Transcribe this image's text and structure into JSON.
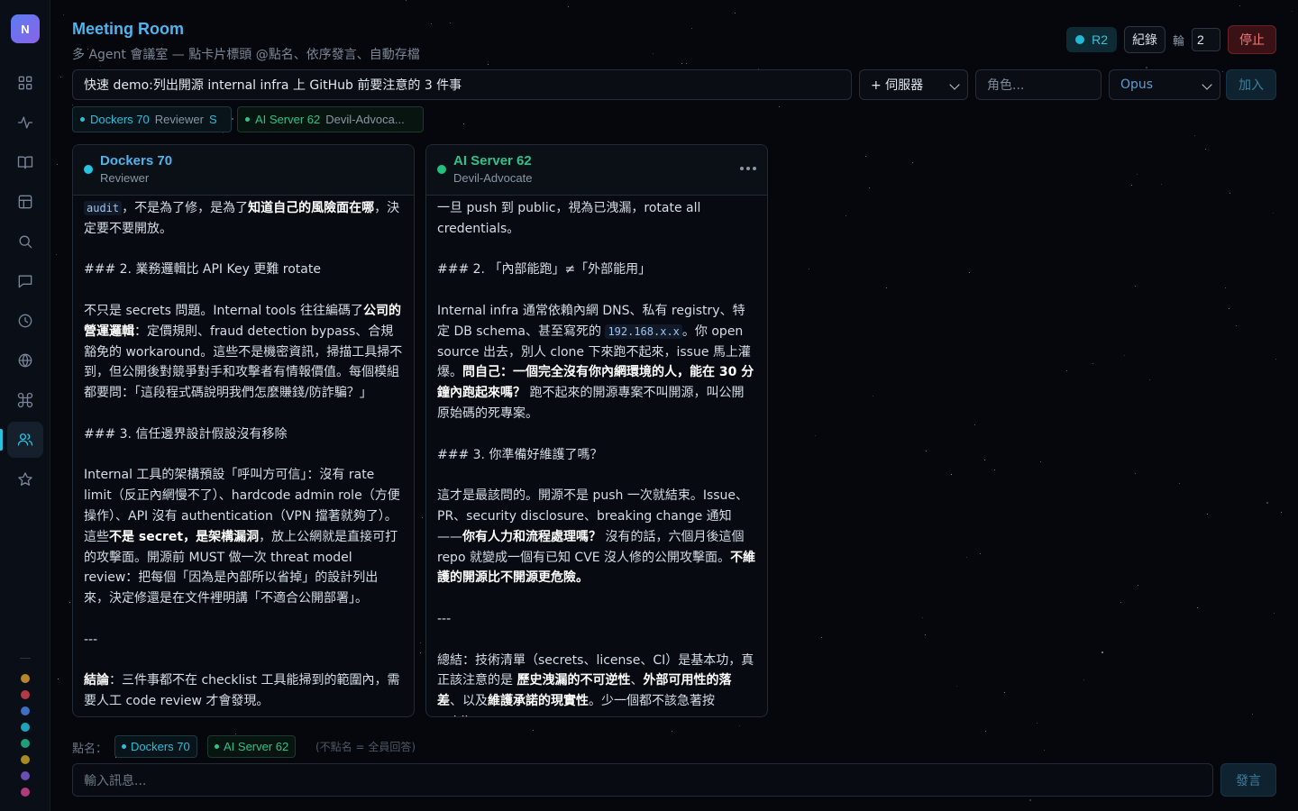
{
  "app": {
    "logo_letter": "N",
    "title": "Meeting Room",
    "subtitle": "多 Agent 會議室 — 點卡片標頭 @點名、依序發言、自動存檔"
  },
  "sidebar": {
    "items": [
      {
        "name": "dashboard",
        "icon": "grid-icon"
      },
      {
        "name": "activity",
        "icon": "activity-icon"
      },
      {
        "name": "docs",
        "icon": "book-icon"
      },
      {
        "name": "layout",
        "icon": "layout-icon"
      },
      {
        "name": "search",
        "icon": "search-icon"
      },
      {
        "name": "chat",
        "icon": "message-icon"
      },
      {
        "name": "history",
        "icon": "clock-icon"
      },
      {
        "name": "network",
        "icon": "globe-icon"
      },
      {
        "name": "commands",
        "icon": "command-icon"
      },
      {
        "name": "meeting",
        "icon": "users-icon",
        "active": true
      },
      {
        "name": "favorites",
        "icon": "star-icon"
      }
    ],
    "status_dots": [
      "#b8862a",
      "#b33a45",
      "#3f6fbf",
      "#1fa3bd",
      "#1f9e7a",
      "#a88a1f",
      "#6a4fb3",
      "#b33a7a"
    ]
  },
  "header": {
    "round_badge": "R2",
    "record_button": "紀錄",
    "round_label": "輪",
    "round_value": "2",
    "stop_button": "停止"
  },
  "controls": {
    "topic_value": "快速 demo:列出開源 internal infra 上 GitHub 前要注意的 3 件事",
    "server_select": "+ 伺服器",
    "role_placeholder": "角色...",
    "model_select": "Opus",
    "join_button": "加入"
  },
  "participants": [
    {
      "name": "Dockers 70",
      "role": "Reviewer",
      "extra": "S",
      "color": "#2bbfdc"
    },
    {
      "name": "AI Server 62",
      "role": "Devil-Advoca...",
      "extra": "",
      "color": "#2ec28a"
    }
  ],
  "cards": [
    {
      "name": "Dockers 70",
      "role": "Reviewer",
      "name_color": "#4fb4ec",
      "status_color": "#27c3e0",
      "paragraphs": [
        [
          {
            "c": "audit"
          },
          {
            "t": "，不是為了修，是為了"
          },
          {
            "b": "知道自己的風險面在哪"
          },
          {
            "t": "，決定要不要開放。"
          }
        ],
        [
          {
            "t": "### 2. 業務邏輯比 API Key 更難 rotate"
          }
        ],
        [
          {
            "t": "不只是 secrets 問題。Internal tools 往往編碼了"
          },
          {
            "b": "公司的營運邏輯"
          },
          {
            "t": "：定價規則、fraud detection bypass、合規豁免的 workaround。這些不是機密資訊，掃描工具掃不到，但公開後對競爭對手和攻擊者有情報價值。每個模組都要問：「這段程式碼說明我們怎麼賺錢/防詐騙？」"
          }
        ],
        [
          {
            "t": "### 3. 信任邊界設計假設沒有移除"
          }
        ],
        [
          {
            "t": "Internal 工具的架構預設「呼叫方可信」：沒有 rate limit（反正內網慢不了）、hardcode admin role（方便操作）、API 沒有 authentication（VPN 擋著就夠了）。這些"
          },
          {
            "b": "不是 secret，是架構漏洞"
          },
          {
            "t": "，放上公網就是直接可打的攻擊面。開源前 MUST 做一次 threat model review：把每個「因為是內部所以省掉」的設計列出來，決定修還是在文件裡明講「不適合公開部署」。"
          }
        ],
        [
          {
            "t": "---"
          }
        ],
        [
          {
            "b": "結論"
          },
          {
            "t": "：三件事都不在 checklist 工具能掃到的範圍內，需要人工 code review 才會發現。"
          }
        ]
      ]
    },
    {
      "name": "AI Server 62",
      "role": "Devil-Advocate",
      "name_color": "#2ec28a",
      "status_color": "#22c07a",
      "paragraphs": [
        [
          {
            "t": "一旦 push 到 public，視為已洩漏，rotate all credentials。"
          }
        ],
        [
          {
            "t": "### 2. 「內部能跑」≠「外部能用」"
          }
        ],
        [
          {
            "t": "Internal infra 通常依賴內網 DNS、私有 registry、特定 DB schema、甚至寫死的 "
          },
          {
            "c": "192.168.x.x"
          },
          {
            "t": "。你 open source 出去，別人 clone 下來跑不起來，issue 馬上灌爆。"
          },
          {
            "b": "問自己：一個完全沒有你內網環境的人，能在 30 分鐘內跑起來嗎？"
          },
          {
            "t": " 跑不起來的開源專案不叫開源，叫公開原始碼的死專案。"
          }
        ],
        [
          {
            "t": "### 3. 你準備好維護了嗎？"
          }
        ],
        [
          {
            "t": "這才是最該問的。開源不是 push 一次就結束。Issue、PR、security disclosure、breaking change 通知——"
          },
          {
            "b": "你有人力和流程處理嗎？"
          },
          {
            "t": " 沒有的話，六個月後這個 repo 就變成一個有已知 CVE 沒人修的公開攻擊面。"
          },
          {
            "b": "不維護的開源比不開源更危險。"
          }
        ],
        [
          {
            "t": "---"
          }
        ],
        [
          {
            "t": "總結：技術清單（secrets、license、CI）是基本功，真正該注意的是 "
          },
          {
            "b": "歷史洩漏的不可逆性"
          },
          {
            "t": "、"
          },
          {
            "b": "外部可用性的落差"
          },
          {
            "t": "、以及"
          },
          {
            "b": "維護承諾的現實性"
          },
          {
            "t": "。少一個都不該急著按 public。"
          }
        ]
      ]
    }
  ],
  "footer": {
    "mention_label": "點名：",
    "mention_chips": [
      {
        "name": "Dockers 70",
        "color": "#2bbfdc"
      },
      {
        "name": "AI Server 62",
        "color": "#2ec28a"
      }
    ],
    "mention_hint": "(不點名 = 全員回答)",
    "message_placeholder": "輸入訊息...",
    "send_button": "發言"
  }
}
